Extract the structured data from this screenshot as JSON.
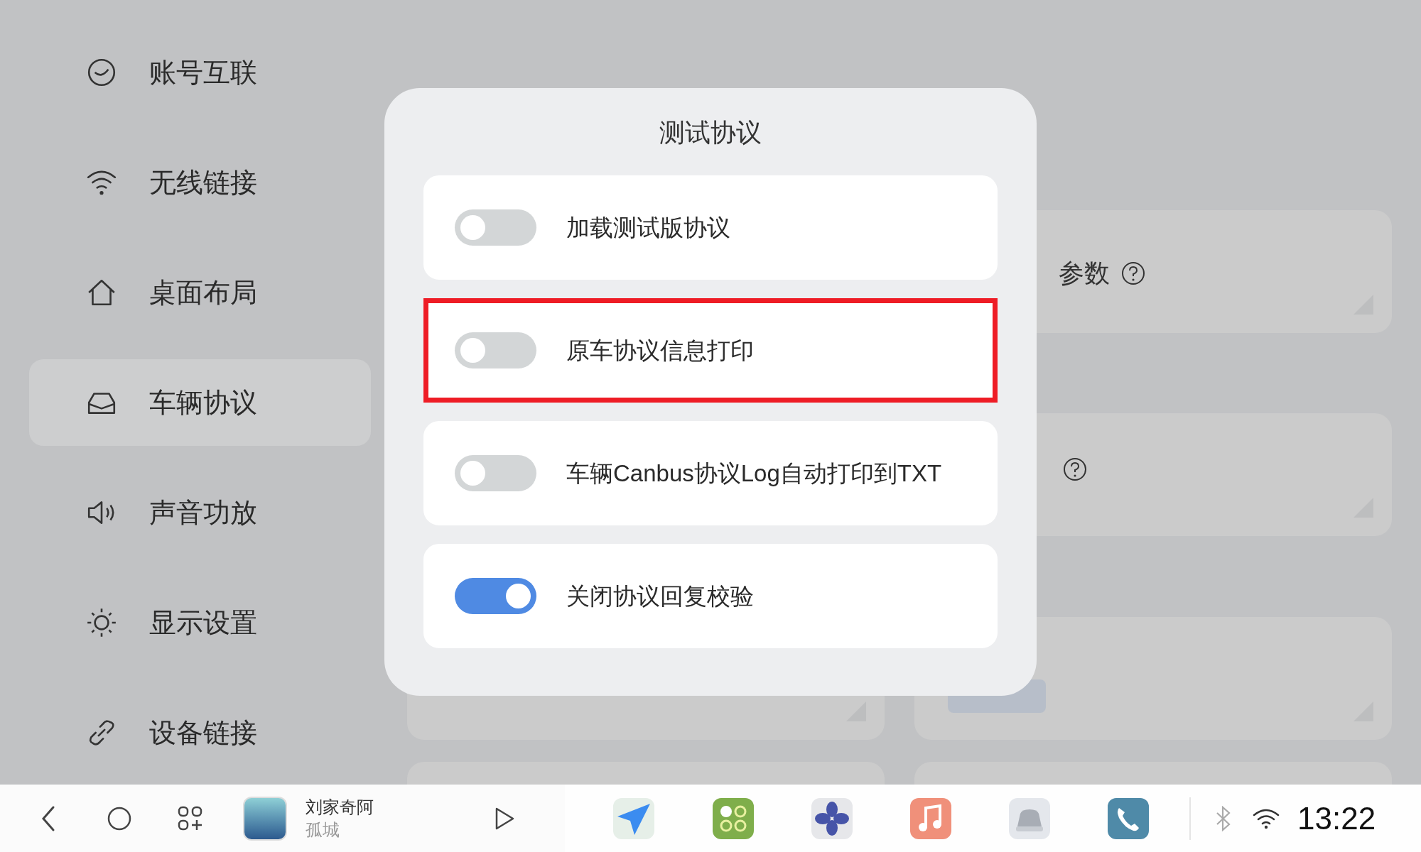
{
  "sidebar": {
    "items": [
      {
        "label": "账号互联",
        "selected": false
      },
      {
        "label": "无线链接",
        "selected": false
      },
      {
        "label": "桌面布局",
        "selected": false
      },
      {
        "label": "车辆协议",
        "selected": true
      },
      {
        "label": "声音功放",
        "selected": false
      },
      {
        "label": "显示设置",
        "selected": false
      },
      {
        "label": "设备链接",
        "selected": false
      }
    ]
  },
  "background_cards": [
    {
      "label": "参数",
      "help": true,
      "button": false
    },
    {
      "help": true,
      "button": false
    },
    {
      "help": false,
      "button": true
    }
  ],
  "dialog": {
    "title": "测试协议",
    "options": [
      {
        "label": "加载测试版协议",
        "on": false,
        "highlighted": false
      },
      {
        "label": "原车协议信息打印",
        "on": false,
        "highlighted": true
      },
      {
        "label": "车辆Canbus协议Log自动打印到TXT",
        "on": false,
        "highlighted": false
      },
      {
        "label": "关闭协议回复校验",
        "on": true,
        "highlighted": false
      }
    ]
  },
  "taskbar": {
    "now_playing": {
      "title": "刘家奇阿",
      "artist": "孤城"
    },
    "time": "13:22"
  }
}
